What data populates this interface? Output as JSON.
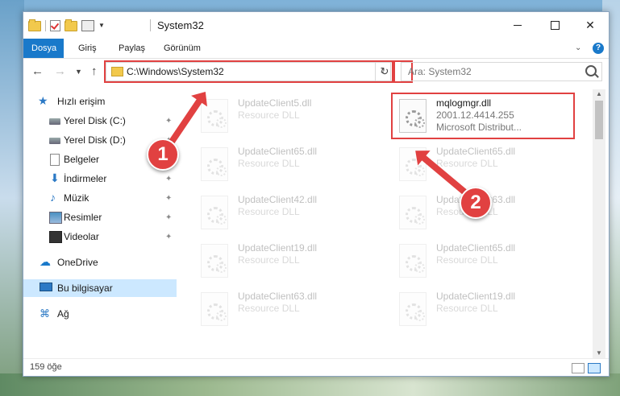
{
  "window": {
    "title": "System32",
    "controls": {
      "minimize": "",
      "maximize": "",
      "close": "✕"
    }
  },
  "ribbon": {
    "tabs": [
      {
        "label": "Dosya",
        "active": true
      },
      {
        "label": "Giriş"
      },
      {
        "label": "Paylaş"
      },
      {
        "label": "Görünüm"
      }
    ],
    "help_label": "?"
  },
  "address": {
    "path": "C:\\Windows\\System32",
    "search_placeholder": "Ara: System32"
  },
  "sidebar": {
    "items": [
      {
        "label": "Hızlı erişim",
        "icon": "star-icon"
      },
      {
        "label": "Yerel Disk (C:)",
        "icon": "drive-icon",
        "pinned": true
      },
      {
        "label": "Yerel Disk (D:)",
        "icon": "drive-icon",
        "pinned": true
      },
      {
        "label": "Belgeler",
        "icon": "document-icon",
        "pinned": true
      },
      {
        "label": "İndirmeler",
        "icon": "download-icon",
        "pinned": true
      },
      {
        "label": "Müzik",
        "icon": "music-icon",
        "pinned": true
      },
      {
        "label": "Resimler",
        "icon": "pictures-icon",
        "pinned": true
      },
      {
        "label": "Videolar",
        "icon": "video-icon",
        "pinned": true
      },
      {
        "label": "OneDrive",
        "icon": "cloud-icon"
      },
      {
        "label": "Bu bilgisayar",
        "icon": "computer-icon",
        "selected": true
      },
      {
        "label": "Ağ",
        "icon": "network-icon"
      }
    ]
  },
  "files": [
    {
      "name": "UpdateClient5.dll",
      "type": "Resource DLL",
      "faded": true
    },
    {
      "name": "mqlogmgr.dll",
      "version": "2001.12.4414.255",
      "company": "Microsoft Distribut...",
      "selected": true
    },
    {
      "name": "UpdateClient65.dll",
      "type": "Resource DLL",
      "faded": true
    },
    {
      "name": "UpdateClient65.dll",
      "type": "Resource DLL",
      "faded": true
    },
    {
      "name": "UpdateClient42.dll",
      "type": "Resource DLL",
      "faded": true
    },
    {
      "name": "UpdateClient63.dll",
      "type": "Resource DLL",
      "faded": true
    },
    {
      "name": "UpdateClient19.dll",
      "type": "Resource DLL",
      "faded": true
    },
    {
      "name": "UpdateClient65.dll",
      "type": "Resource DLL",
      "faded": true
    },
    {
      "name": "UpdateClient63.dll",
      "type": "Resource DLL",
      "faded": true
    },
    {
      "name": "UpdateClient19.dll",
      "type": "Resource DLL",
      "faded": true
    }
  ],
  "status": {
    "item_count": "159 öğe"
  },
  "callouts": {
    "step1": "1",
    "step2": "2"
  },
  "colors": {
    "accent": "#1979ca",
    "highlight": "#e14141",
    "selection": "#cce8ff"
  }
}
